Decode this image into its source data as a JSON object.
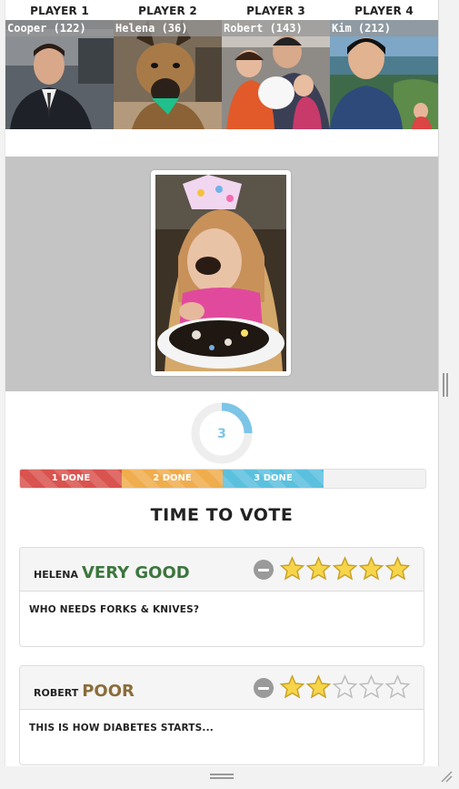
{
  "players": [
    {
      "header": "PLAYER 1",
      "name": "Cooper (122)"
    },
    {
      "header": "PLAYER 2",
      "name": "Helena (36)"
    },
    {
      "header": "PLAYER 3",
      "name": "Robert (143)"
    },
    {
      "header": "PLAYER 4",
      "name": "Kim (212)"
    }
  ],
  "timer": {
    "value": "3",
    "fraction": 0.25
  },
  "progress": [
    {
      "label": "1 DONE",
      "color": "#d9534f"
    },
    {
      "label": "2 DONE",
      "color": "#f0ad4e"
    },
    {
      "label": "3 DONE",
      "color": "#5bc0de"
    }
  ],
  "vote_title": "TIME TO VOTE",
  "votes": [
    {
      "voter": "HELENA",
      "rating": "VERY GOOD",
      "rating_color": "#3c763d",
      "stars": 5,
      "comment": "WHO NEEDS FORKS & KNIVES?"
    },
    {
      "voter": "ROBERT",
      "rating": "POOR",
      "rating_color": "#8a6d3b",
      "stars": 2,
      "comment": "THIS IS HOW DIABETES STARTS..."
    }
  ]
}
